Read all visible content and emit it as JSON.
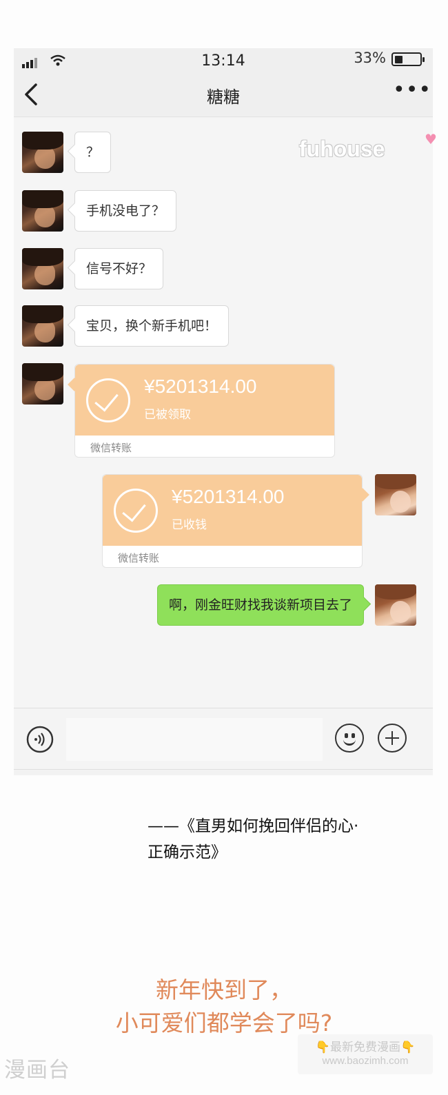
{
  "status_bar": {
    "time": "13:14",
    "battery_percent_text": "33%",
    "battery_level": 0.33
  },
  "nav": {
    "title": "糖糖",
    "more_label": "•••"
  },
  "messages": [
    {
      "side": "left",
      "type": "text",
      "text": "？"
    },
    {
      "side": "left",
      "type": "text",
      "text": "手机没电了？"
    },
    {
      "side": "left",
      "type": "text",
      "text": "信号不好？"
    },
    {
      "side": "left",
      "type": "text",
      "text": "宝贝，换个新手机吧！"
    },
    {
      "side": "left",
      "type": "transfer",
      "amount": "¥5201314.00",
      "status": "已被领取",
      "label": "微信转账"
    },
    {
      "side": "right",
      "type": "transfer",
      "amount": "¥5201314.00",
      "status": "已收钱",
      "label": "微信转账"
    },
    {
      "side": "right",
      "type": "text",
      "text": "啊，刚金旺财找我谈新项目去了"
    }
  ],
  "input_bar": {
    "placeholder": "",
    "icons": [
      "voice-icon",
      "emoji-icon",
      "plus-icon"
    ]
  },
  "watermark": "fuhouse",
  "caption": {
    "line1": "——《直男如何挽回伴侣的心·",
    "line2": "正确示范》"
  },
  "promo": {
    "line1": "新年快到了，",
    "line2": "小可爱们都学会了吗?"
  },
  "footer": {
    "site_logo": "漫画台",
    "promo_line1": "👇最新免费漫画👇",
    "promo_line2": "www.baozimh.com"
  },
  "colors": {
    "transfer_orange": "#f9cc9a",
    "bubble_green": "#8fe05a",
    "promo_text": "#e0895a"
  }
}
